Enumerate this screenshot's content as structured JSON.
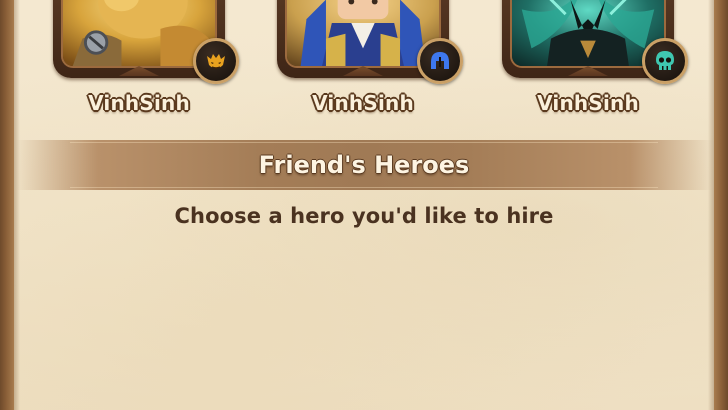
{
  "heroes": [
    {
      "owner_name": "VinhSinh",
      "class_icon": "demon-face-icon",
      "accent": "#e0a020"
    },
    {
      "owner_name": "VinhSinh",
      "class_icon": "helmet-icon",
      "accent": "#2f66d8"
    },
    {
      "owner_name": "VinhSinh",
      "class_icon": "skull-icon",
      "accent": "#3fc7b0"
    }
  ],
  "section": {
    "title": "Friend's Heroes"
  },
  "instruction": {
    "text": "Choose a hero you'd like to hire"
  },
  "colors": {
    "parchment": "#f2e6cc",
    "banner": "#a47d57",
    "frame_wood": "#6e4a2b",
    "name_text": "#fbf1dc",
    "instruction_text": "#4a3220"
  }
}
